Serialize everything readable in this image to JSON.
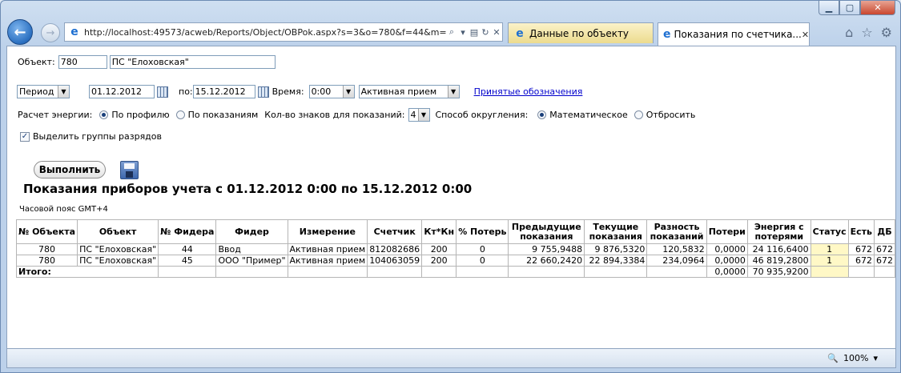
{
  "browser": {
    "url": "http://localhost:49573/acweb/Reports/Object/OBPok.aspx?s=3&o=780&f=44&m=",
    "tabs": [
      {
        "label": "Данные по объекту",
        "active": false
      },
      {
        "label": "Показания по счетчика...",
        "active": true
      }
    ],
    "zoom": "100%"
  },
  "form": {
    "object_label": "Объект:",
    "object_id": "780",
    "object_name": "ПС \"Елоховская\"",
    "period_select": "Период",
    "date_from": "01.12.2012",
    "to_label": "по:",
    "date_to": "15.12.2012",
    "time_label": "Время:",
    "time_value": "0:00",
    "measurement_value": "Активная прием",
    "legend_link": "Принятые обозначения",
    "energy_calc_label": "Расчет энергии:",
    "by_profile": "По профилю",
    "by_readings": "По показаниям",
    "digits_label": "Кол-во знаков для показаний:",
    "digits_value": "4",
    "rounding_label": "Способ округления:",
    "rounding_math": "Математическое",
    "rounding_drop": "Отбросить",
    "group_digits_label": "Выделить группы разрядов",
    "run_button": "Выполнить"
  },
  "report": {
    "title": "Показания приборов учета с 01.12.2012 0:00 по 15.12.2012 0:00",
    "timezone": "Часовой пояс GMT+4",
    "headers": {
      "obj_no": "№ Объекта",
      "obj": "Объект",
      "feeder_no": "№ Фидера",
      "feeder": "Фидер",
      "measure": "Измерение",
      "meter": "Счетчик",
      "ktkn": "Кт*Кн",
      "loss_pct": "% Потерь",
      "prev": "Предыдущие показания",
      "curr": "Текущие показания",
      "diff": "Разность показаний",
      "losses": "Потери",
      "energy": "Энергия с потерями",
      "status": "Статус",
      "est": "Есть",
      "db": "ДБ"
    },
    "rows": [
      {
        "obj_no": "780",
        "obj": "ПС \"Елоховская\"",
        "feeder_no": "44",
        "feeder": "Ввод",
        "measure": "Активная прием",
        "meter": "812082686",
        "ktkn": "200",
        "loss_pct": "0",
        "prev": "9 755,9488",
        "curr": "9 876,5320",
        "diff": "120,5832",
        "losses": "0,0000",
        "energy": "24 116,6400",
        "status": "1",
        "est": "672",
        "db": "672"
      },
      {
        "obj_no": "780",
        "obj": "ПС \"Елоховская\"",
        "feeder_no": "45",
        "feeder": "ООО \"Пример\"",
        "measure": "Активная прием",
        "meter": "104063059",
        "ktkn": "200",
        "loss_pct": "0",
        "prev": "22 660,2420",
        "curr": "22 894,3384",
        "diff": "234,0964",
        "losses": "0,0000",
        "energy": "46 819,2800",
        "status": "1",
        "est": "672",
        "db": "672"
      }
    ],
    "total": {
      "label": "Итого:",
      "losses": "0,0000",
      "energy": "70 935,9200"
    }
  }
}
